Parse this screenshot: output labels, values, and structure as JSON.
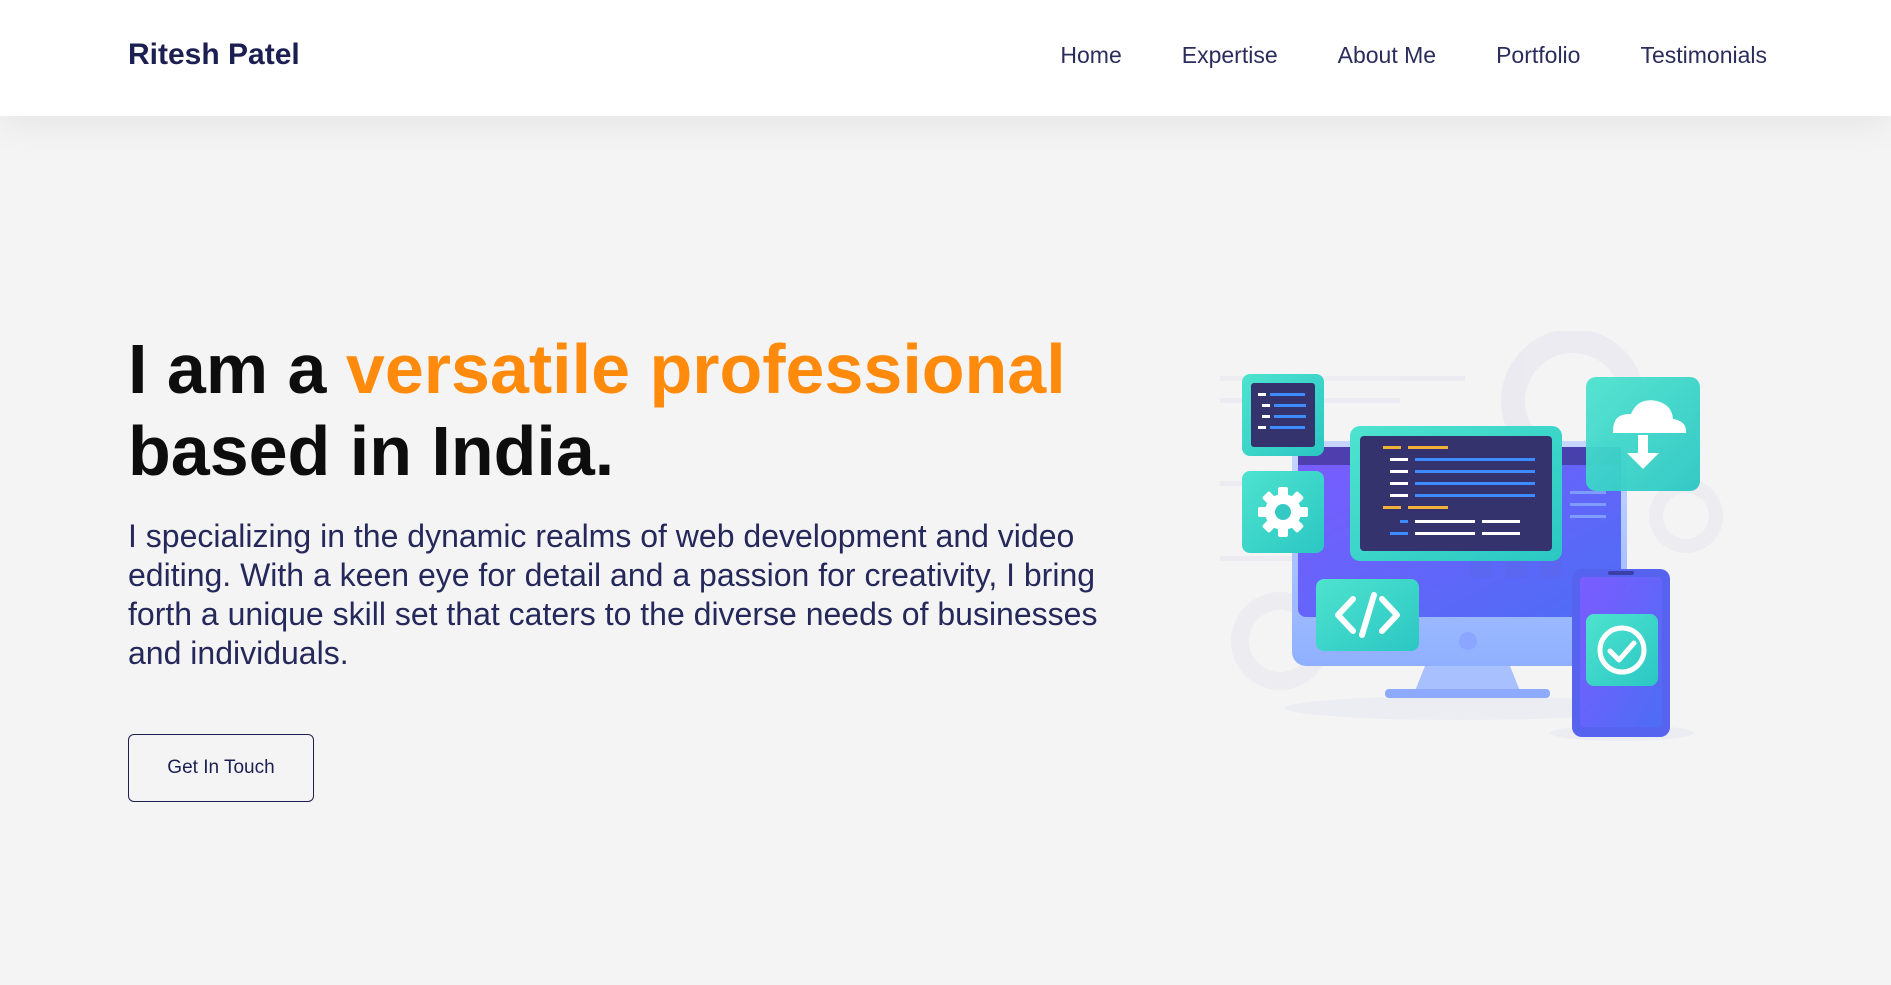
{
  "header": {
    "brand": "Ritesh Patel",
    "nav": [
      "Home",
      "Expertise",
      "About Me",
      "Portfolio",
      "Testimonials"
    ]
  },
  "hero": {
    "headline_prefix": "I am a ",
    "headline_accent": "versatile professional",
    "headline_suffix": "based in India.",
    "description": "I specializing in the dynamic realms of web development and video editing. With a keen eye for detail and a passion for creativity, I bring forth a unique skill set that caters to the diverse needs of businesses and individuals.",
    "cta_label": "Get In Touch",
    "illustration_icons": [
      "code-window-icon",
      "gear-icon",
      "code-tag-icon",
      "cloud-download-icon",
      "check-icon",
      "smartphone-icon",
      "monitor-icon"
    ]
  },
  "colors": {
    "accent": "#ff8a0c",
    "navy": "#1c1f52",
    "background": "#f4f4f4",
    "illustration_purple": "#6b4cf2",
    "illustration_teal": "#39d6c7"
  }
}
